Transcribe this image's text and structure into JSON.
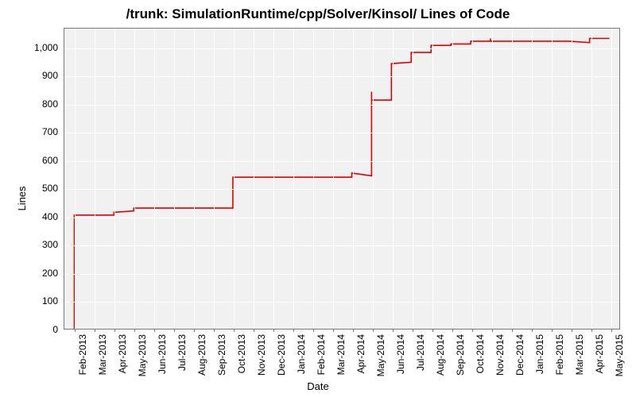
{
  "chart_data": {
    "type": "line",
    "title": "/trunk: SimulationRuntime/cpp/Solver/Kinsol/ Lines of Code",
    "xlabel": "Date",
    "ylabel": "Lines",
    "ylim": [
      0,
      1070
    ],
    "y_ticks": [
      0,
      100,
      200,
      300,
      400,
      500,
      600,
      700,
      800,
      900,
      1000
    ],
    "x_categories": [
      "Feb-2013",
      "Mar-2013",
      "Apr-2013",
      "May-2013",
      "Jun-2013",
      "Jul-2013",
      "Aug-2013",
      "Sep-2013",
      "Oct-2013",
      "Nov-2013",
      "Dec-2013",
      "Jan-2014",
      "Feb-2014",
      "Mar-2014",
      "Apr-2014",
      "May-2014",
      "Jun-2014",
      "Jul-2014",
      "Aug-2014",
      "Sep-2014",
      "Oct-2014",
      "Nov-2014",
      "Dec-2014",
      "Jan-2015",
      "Feb-2015",
      "Mar-2015",
      "Apr-2015",
      "May-2015"
    ],
    "series": [
      {
        "name": "Lines of Code",
        "color": "#e60000",
        "points": [
          {
            "x": "Feb-2013",
            "y": 0
          },
          {
            "x": "Feb-2013",
            "y": 405
          },
          {
            "x": "Apr-2013",
            "y": 405
          },
          {
            "x": "Apr-2013",
            "y": 415
          },
          {
            "x": "May-2013",
            "y": 420
          },
          {
            "x": "May-2013",
            "y": 430
          },
          {
            "x": "Sep-2013",
            "y": 430
          },
          {
            "x": "Oct-2013",
            "y": 430
          },
          {
            "x": "Oct-2013",
            "y": 540
          },
          {
            "x": "Apr-2014",
            "y": 540
          },
          {
            "x": "Apr-2014",
            "y": 555
          },
          {
            "x": "May-2014",
            "y": 545
          },
          {
            "x": "May-2014",
            "y": 680
          },
          {
            "x": "May-2014",
            "y": 705
          },
          {
            "x": "May-2014",
            "y": 845
          },
          {
            "x": "May-2014",
            "y": 815
          },
          {
            "x": "Jun-2014",
            "y": 815
          },
          {
            "x": "Jun-2014",
            "y": 935
          },
          {
            "x": "Jun-2014",
            "y": 945
          },
          {
            "x": "Jul-2014",
            "y": 950
          },
          {
            "x": "Jul-2014",
            "y": 985
          },
          {
            "x": "Aug-2014",
            "y": 985
          },
          {
            "x": "Aug-2014",
            "y": 1010
          },
          {
            "x": "Sep-2014",
            "y": 1010
          },
          {
            "x": "Sep-2014",
            "y": 1015
          },
          {
            "x": "Oct-2014",
            "y": 1015
          },
          {
            "x": "Oct-2014",
            "y": 1025
          },
          {
            "x": "Nov-2014",
            "y": 1025
          },
          {
            "x": "Nov-2014",
            "y": 1035
          },
          {
            "x": "Nov-2014",
            "y": 1025
          },
          {
            "x": "Mar-2015",
            "y": 1025
          },
          {
            "x": "Apr-2015",
            "y": 1020
          },
          {
            "x": "Apr-2015",
            "y": 1035
          },
          {
            "x": "May-2015",
            "y": 1035
          }
        ]
      }
    ]
  }
}
